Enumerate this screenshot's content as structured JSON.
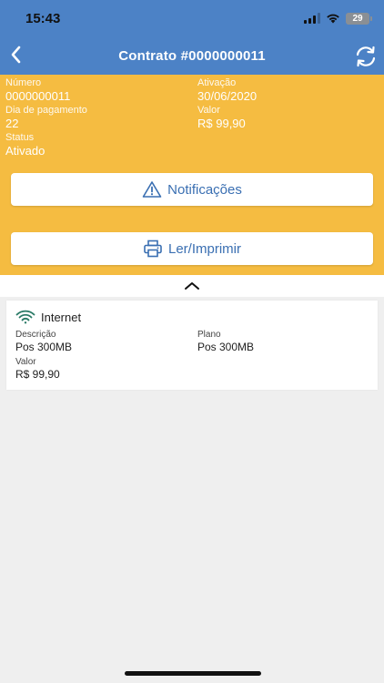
{
  "status_bar": {
    "time": "15:43",
    "battery": "29"
  },
  "header": {
    "title": "Contrato #0000000011"
  },
  "contract": {
    "numero": {
      "label": "Número",
      "value": "0000000011"
    },
    "ativacao": {
      "label": "Ativação",
      "value": "30/06/2020"
    },
    "dia_pagamento": {
      "label": "Dia de pagamento",
      "value": "22"
    },
    "valor": {
      "label": "Valor",
      "value": "R$ 99,90"
    },
    "status": {
      "label": "Status",
      "value": "Ativado"
    }
  },
  "buttons": {
    "notificacoes": "Notificações",
    "ler_imprimir": "Ler/Imprimir"
  },
  "service": {
    "title": "Internet",
    "descricao": {
      "label": "Descrição",
      "value": "Pos 300MB"
    },
    "plano": {
      "label": "Plano",
      "value": "Pos 300MB"
    },
    "valor": {
      "label": "Valor",
      "value": "R$ 99,90"
    }
  },
  "colors": {
    "header": "#4c82c6",
    "panel": "#f5bc41",
    "accent": "#3a6fb2",
    "wifi": "#2a7a66"
  },
  "icons": [
    "chevron-left-icon",
    "refresh-icon",
    "warning-icon",
    "printer-icon",
    "chevron-up-icon",
    "wifi-icon"
  ]
}
